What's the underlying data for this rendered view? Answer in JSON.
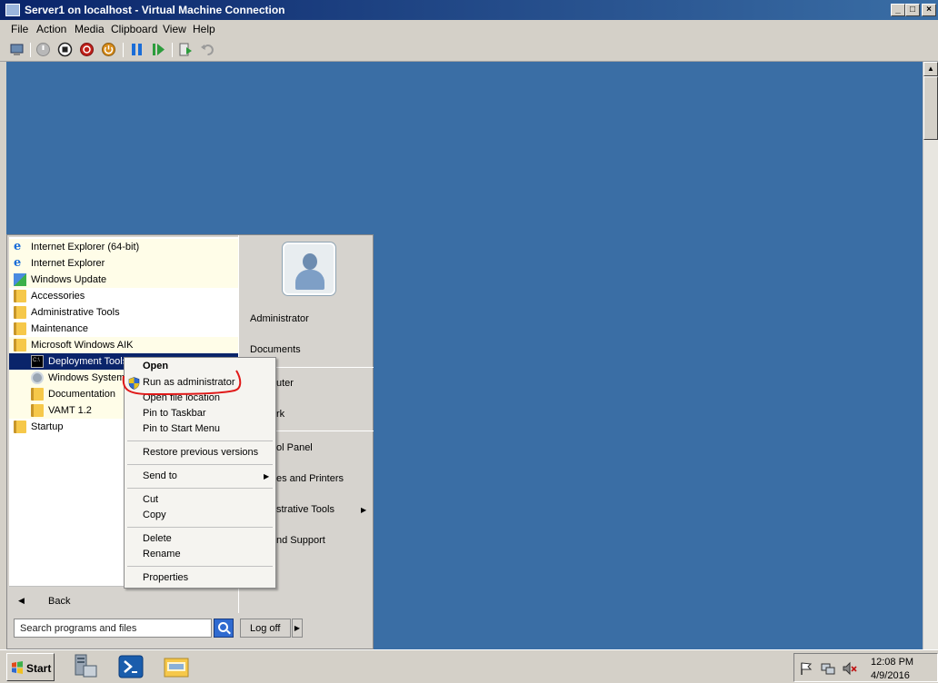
{
  "window": {
    "title": "Server1 on localhost - Virtual Machine Connection",
    "minimize_glyph": "_",
    "maximize_glyph": "□",
    "close_glyph": "×"
  },
  "menubar": {
    "items": [
      "File",
      "Action",
      "Media",
      "Clipboard",
      "View",
      "Help"
    ]
  },
  "toolbar": {
    "buttons": [
      {
        "name": "ctrl-alt-del",
        "icon": "ctrl-alt-del-icon"
      },
      {
        "name": "start",
        "icon": "start-icon"
      },
      {
        "name": "turn-off",
        "icon": "turn-off-icon"
      },
      {
        "name": "shut-down",
        "icon": "shut-down-icon"
      },
      {
        "name": "save",
        "icon": "save-icon"
      },
      {
        "name": "pause",
        "icon": "pause-icon"
      },
      {
        "name": "reset",
        "icon": "reset-icon"
      },
      {
        "name": "snapshot",
        "icon": "snapshot-icon"
      },
      {
        "name": "revert",
        "icon": "revert-icon"
      }
    ],
    "colors": {
      "blue": "#1a6dd8",
      "red": "#c0201a",
      "orange": "#d88c1a",
      "green": "#2c9c3c",
      "gray": "#8a8a8a"
    }
  },
  "desktop": {
    "background": "#3a6ea5"
  },
  "start_menu": {
    "programs": [
      {
        "label": "Internet Explorer (64-bit)",
        "icon": "ie-icon",
        "indent": 0
      },
      {
        "label": "Internet Explorer",
        "icon": "ie-icon",
        "indent": 0
      },
      {
        "label": "Windows Update",
        "icon": "windows-update-icon",
        "indent": 0
      },
      {
        "label": "Accessories",
        "icon": "folder-icon",
        "indent": 0
      },
      {
        "label": "Administrative Tools",
        "icon": "folder-icon",
        "indent": 0
      },
      {
        "label": "Maintenance",
        "icon": "folder-icon",
        "indent": 0
      },
      {
        "label": "Microsoft Windows AIK",
        "icon": "folder-icon",
        "indent": 0
      },
      {
        "label": "Deployment Tools",
        "icon": "cmd-icon",
        "indent": 1
      },
      {
        "label": "Windows System",
        "icon": "gear-icon",
        "indent": 1
      },
      {
        "label": "Documentation",
        "icon": "folder-icon",
        "indent": 1
      },
      {
        "label": "VAMT 1.2",
        "icon": "folder-icon",
        "indent": 1
      },
      {
        "label": "Startup",
        "icon": "folder-icon",
        "indent": 0
      }
    ],
    "back_label": "Back",
    "search_placeholder": "Search programs and files",
    "user": "Administrator",
    "right_items": [
      "Administrator",
      "Documents",
      "uter",
      "rk",
      "ol Panel",
      "es and Printers",
      "strative Tools",
      "nd Support"
    ],
    "logoff_label": "Log off",
    "arrow_glyph": "▶",
    "back_glyph": "◀"
  },
  "context_menu": {
    "items": [
      {
        "label": "Open",
        "bold": true
      },
      {
        "label": "Run as administrator",
        "shield": true
      },
      {
        "label": "Open file location"
      },
      {
        "label": "Pin to Taskbar"
      },
      {
        "label": "Pin to Start Menu"
      },
      {
        "label": "Restore previous versions"
      },
      {
        "label": "Send to",
        "submenu": true
      },
      {
        "label": "Cut"
      },
      {
        "label": "Copy"
      },
      {
        "label": "Delete"
      },
      {
        "label": "Rename"
      },
      {
        "label": "Properties"
      }
    ]
  },
  "taskbar": {
    "start_label": "Start",
    "clock_time": "12:08 PM",
    "clock_date": "4/9/2016"
  }
}
